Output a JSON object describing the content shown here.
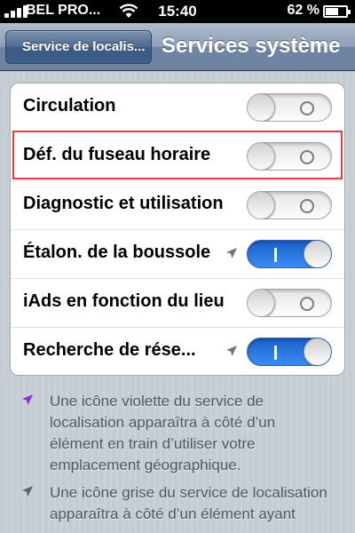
{
  "status_bar": {
    "carrier": "BEL PRO...",
    "time": "15:40",
    "battery_percent": "62 %",
    "battery_level": 0.62
  },
  "nav": {
    "back_label": "Service de localis...",
    "title": "Services système"
  },
  "settings": [
    {
      "label": "Circulation",
      "enabled": false,
      "location_icon": false
    },
    {
      "label": "Déf. du fuseau horaire",
      "enabled": false,
      "location_icon": false,
      "highlighted": true
    },
    {
      "label": "Diagnostic et utilisation",
      "enabled": false,
      "location_icon": false
    },
    {
      "label": "Étalon. de la boussole",
      "enabled": true,
      "location_icon": "gray-arrow"
    },
    {
      "label": "iAds en fonction du lieu",
      "enabled": false,
      "location_icon": false
    },
    {
      "label": "Recherche de rése...",
      "enabled": true,
      "location_icon": "gray-arrow"
    }
  ],
  "notes": [
    {
      "icon": "purple-location-arrow-icon",
      "color": "#8b2fd8",
      "text": "Une icône violette du service de localisation apparaîtra à côté d’un élément en train d’utiliser votre emplacement géographique."
    },
    {
      "icon": "gray-location-arrow-icon",
      "color": "#5d636b",
      "text": "Une icône grise du service de localisation apparaîtra à côté d’un élément ayant"
    }
  ],
  "colors": {
    "toggle_on": "#2f7de8",
    "highlight": "#e03c3c",
    "nav_bar": "#6d84a2"
  }
}
